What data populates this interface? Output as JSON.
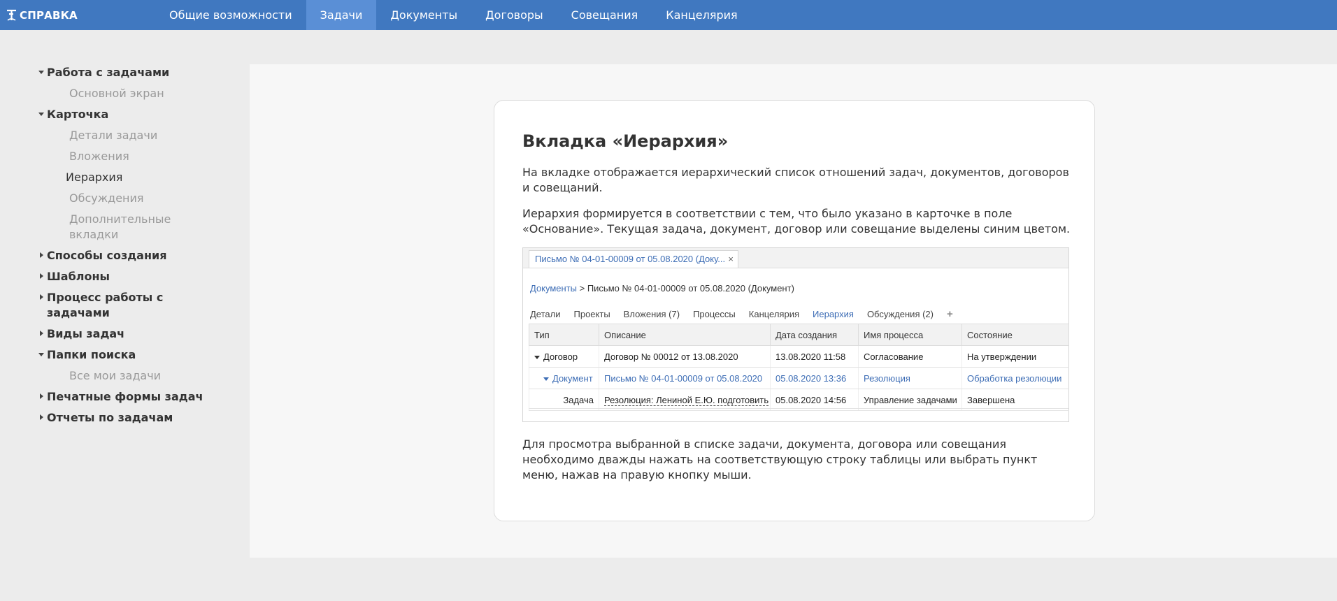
{
  "header": {
    "logo_text": "СПРАВКА",
    "nav": [
      {
        "label": "Общие возможности",
        "active": false
      },
      {
        "label": "Задачи",
        "active": true
      },
      {
        "label": "Документы",
        "active": false
      },
      {
        "label": "Договоры",
        "active": false
      },
      {
        "label": "Совещания",
        "active": false
      },
      {
        "label": "Канцелярия",
        "active": false
      }
    ]
  },
  "sidebar": {
    "items": [
      {
        "label": "Работа с задачами",
        "kind": "section",
        "expanded": true
      },
      {
        "label": "Основной экран",
        "kind": "sub"
      },
      {
        "label": "Карточка",
        "kind": "section",
        "expanded": true
      },
      {
        "label": "Детали задачи",
        "kind": "sub"
      },
      {
        "label": "Вложения",
        "kind": "sub"
      },
      {
        "label": "Иерархия",
        "kind": "current"
      },
      {
        "label": "Обсуждения",
        "kind": "sub"
      },
      {
        "label": "Дополнительные",
        "kind": "sub"
      },
      {
        "label": "вкладки",
        "kind": "sub"
      },
      {
        "label": "Способы создания",
        "kind": "section",
        "expanded": false
      },
      {
        "label": "Шаблоны",
        "kind": "section",
        "expanded": false
      },
      {
        "label": "Процесс работы с",
        "kind": "section",
        "expanded": false
      },
      {
        "label": "задачами",
        "kind": "section"
      },
      {
        "label": "Виды задач",
        "kind": "section",
        "expanded": false
      },
      {
        "label": "Папки поиска",
        "kind": "section",
        "expanded": true
      },
      {
        "label": "Все мои задачи",
        "kind": "sub"
      },
      {
        "label": "Печатные формы задач",
        "kind": "section",
        "expanded": false
      },
      {
        "label": "Отчеты по задачам",
        "kind": "section",
        "expanded": false
      }
    ]
  },
  "article": {
    "title": "Вкладка «Иерархия»",
    "p1": "На вкладке отображается иерархический список отношений задач, документов, договоров и совещаний.",
    "p2": "Иерархия формируется в соответствии с тем, что было указано в карточке в поле «Основание». Текущая задача, документ, договор или совещание выделены синим цветом.",
    "p3": "Для просмотра выбранной в списке задачи, документа, договора или совещания необходимо дважды нажать на соответствующую строку таблицы или выбрать пункт меню, нажав на правую кнопку мыши."
  },
  "screenshot": {
    "tab_label": "Письмо № 04-01-00009 от 05.08.2020 (Доку...",
    "close_glyph": "×",
    "crumb_link": "Документы",
    "crumb_rest": " > Письмо № 04-01-00009 от 05.08.2020 (Документ)",
    "tabs": [
      "Детали",
      "Проекты",
      "Вложения (7)",
      "Процессы",
      "Канцелярия",
      "Иерархия",
      "Обсуждения (2)"
    ],
    "active_tab": "Иерархия",
    "plus_glyph": "+",
    "columns": [
      "Тип",
      "Описание",
      "Дата создания",
      "Имя процесса",
      "Состояние"
    ],
    "rows": [
      {
        "type": "Договор",
        "desc": "Договор № 00012 от 13.08.2020",
        "date": "13.08.2020 11:58",
        "process": "Согласование",
        "state": "На утверждении"
      },
      {
        "type": "Документ",
        "desc": "Письмо № 04-01-00009 от 05.08.2020",
        "date": "05.08.2020 13:36",
        "process": "Резолюция",
        "state": "Обработка резолюции"
      },
      {
        "type": "Задача",
        "desc": "Резолюция: Лениной Е.Ю. подготовить",
        "date": "05.08.2020 14:56",
        "process": "Управление задачами",
        "state": "Завершена"
      }
    ]
  },
  "colors": {
    "topbar": "#4078c0",
    "active_nav": "#5a8fd6",
    "link_blue": "#3d6db5"
  }
}
